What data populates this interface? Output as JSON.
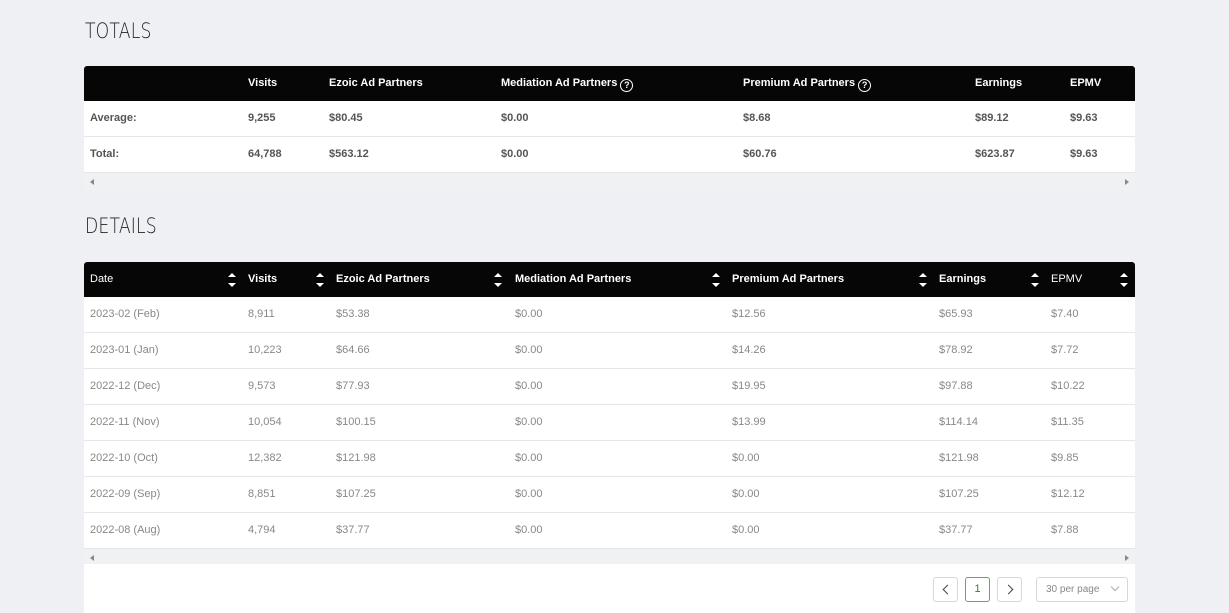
{
  "totals": {
    "title": "TOTALS",
    "headers": [
      "",
      "Visits",
      "Ezoic Ad Partners",
      "Mediation Ad Partners",
      "Premium Ad Partners",
      "Earnings",
      "EPMV"
    ],
    "rows": [
      [
        "Average:",
        "9,255",
        "$80.45",
        "$0.00",
        "$8.68",
        "$89.12",
        "$9.63"
      ],
      [
        "Total:",
        "64,788",
        "$563.12",
        "$0.00",
        "$60.76",
        "$623.87",
        "$9.63"
      ]
    ]
  },
  "details": {
    "title": "DETAILS",
    "headers": [
      "Date",
      "Visits",
      "Ezoic Ad Partners",
      "Mediation Ad Partners",
      "Premium Ad Partners",
      "Earnings",
      "EPMV"
    ],
    "rows": [
      [
        "2023-02 (Feb)",
        "8,911",
        "$53.38",
        "$0.00",
        "$12.56",
        "$65.93",
        "$7.40"
      ],
      [
        "2023-01 (Jan)",
        "10,223",
        "$64.66",
        "$0.00",
        "$14.26",
        "$78.92",
        "$7.72"
      ],
      [
        "2022-12 (Dec)",
        "9,573",
        "$77.93",
        "$0.00",
        "$19.95",
        "$97.88",
        "$10.22"
      ],
      [
        "2022-11 (Nov)",
        "10,054",
        "$100.15",
        "$0.00",
        "$13.99",
        "$114.14",
        "$11.35"
      ],
      [
        "2022-10 (Oct)",
        "12,382",
        "$121.98",
        "$0.00",
        "$0.00",
        "$121.98",
        "$9.85"
      ],
      [
        "2022-09 (Sep)",
        "8,851",
        "$107.25",
        "$0.00",
        "$0.00",
        "$107.25",
        "$12.12"
      ],
      [
        "2022-08 (Aug)",
        "4,794",
        "$37.77",
        "$0.00",
        "$0.00",
        "$37.77",
        "$7.88"
      ]
    ]
  },
  "pagination": {
    "current_page": "1",
    "per_page": "30 per page"
  },
  "icons": {
    "help": "question-circle-icon",
    "sort": "sort-arrows-icon",
    "prev": "chevron-left-icon",
    "next": "chevron-right-icon",
    "dropdown": "chevron-down-icon"
  },
  "colors": {
    "header_bg": "#060606",
    "page_bg": "#eef0f3",
    "active_page": "#6aa84f"
  }
}
